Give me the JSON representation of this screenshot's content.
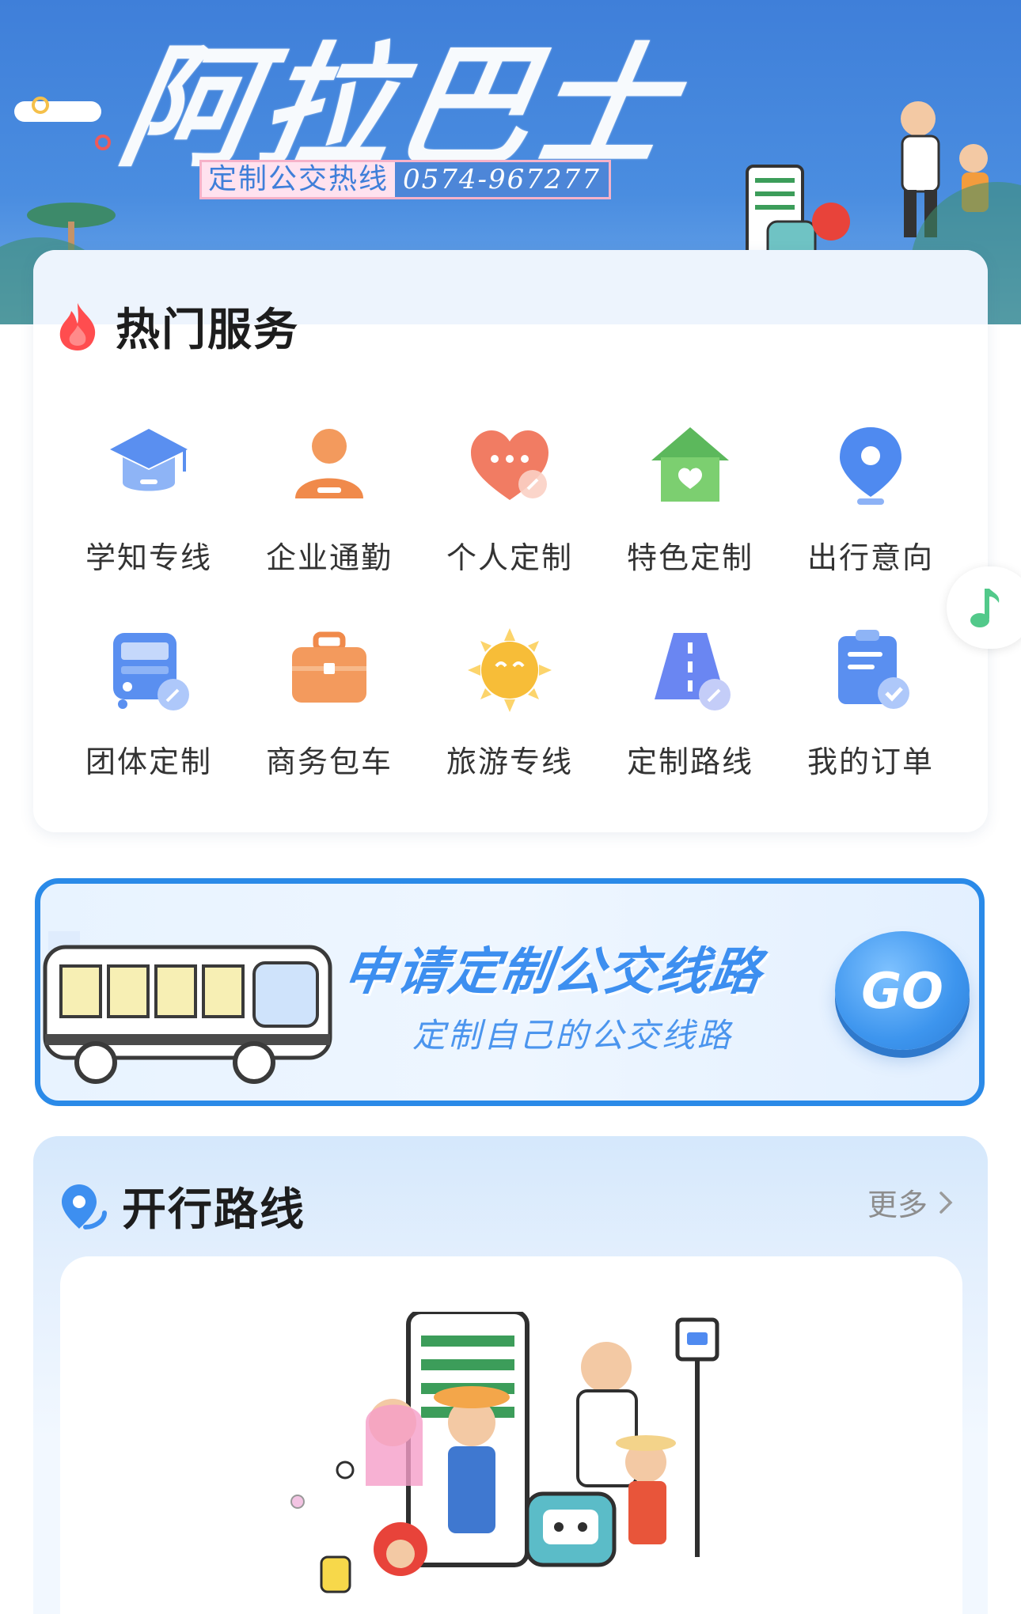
{
  "banner": {
    "title": "阿拉巴士",
    "hotline_label": "定制公交热线",
    "hotline_number": "0574-967277"
  },
  "hot_services": {
    "title": "热门服务",
    "items": [
      {
        "label": "学知专线",
        "icon": "graduation-cap-icon"
      },
      {
        "label": "企业通勤",
        "icon": "person-icon"
      },
      {
        "label": "个人定制",
        "icon": "heart-chat-icon"
      },
      {
        "label": "特色定制",
        "icon": "house-heart-icon"
      },
      {
        "label": "出行意向",
        "icon": "location-pin-icon"
      },
      {
        "label": "团体定制",
        "icon": "bus-edit-icon"
      },
      {
        "label": "商务包车",
        "icon": "briefcase-icon"
      },
      {
        "label": "旅游专线",
        "icon": "sun-smile-icon"
      },
      {
        "label": "定制路线",
        "icon": "road-edit-icon"
      },
      {
        "label": "我的订单",
        "icon": "clipboard-check-icon"
      }
    ]
  },
  "apply_banner": {
    "title": "申请定制公交线路",
    "subtitle": "定制自己的公交线路",
    "go_label": "GO"
  },
  "routes": {
    "title": "开行路线",
    "more_label": "更多"
  },
  "colors": {
    "banner_blue": "#4a8de0",
    "accent_blue": "#2a8ae8",
    "hot_red": "#ff4d4f",
    "music_green": "#52c98a"
  }
}
